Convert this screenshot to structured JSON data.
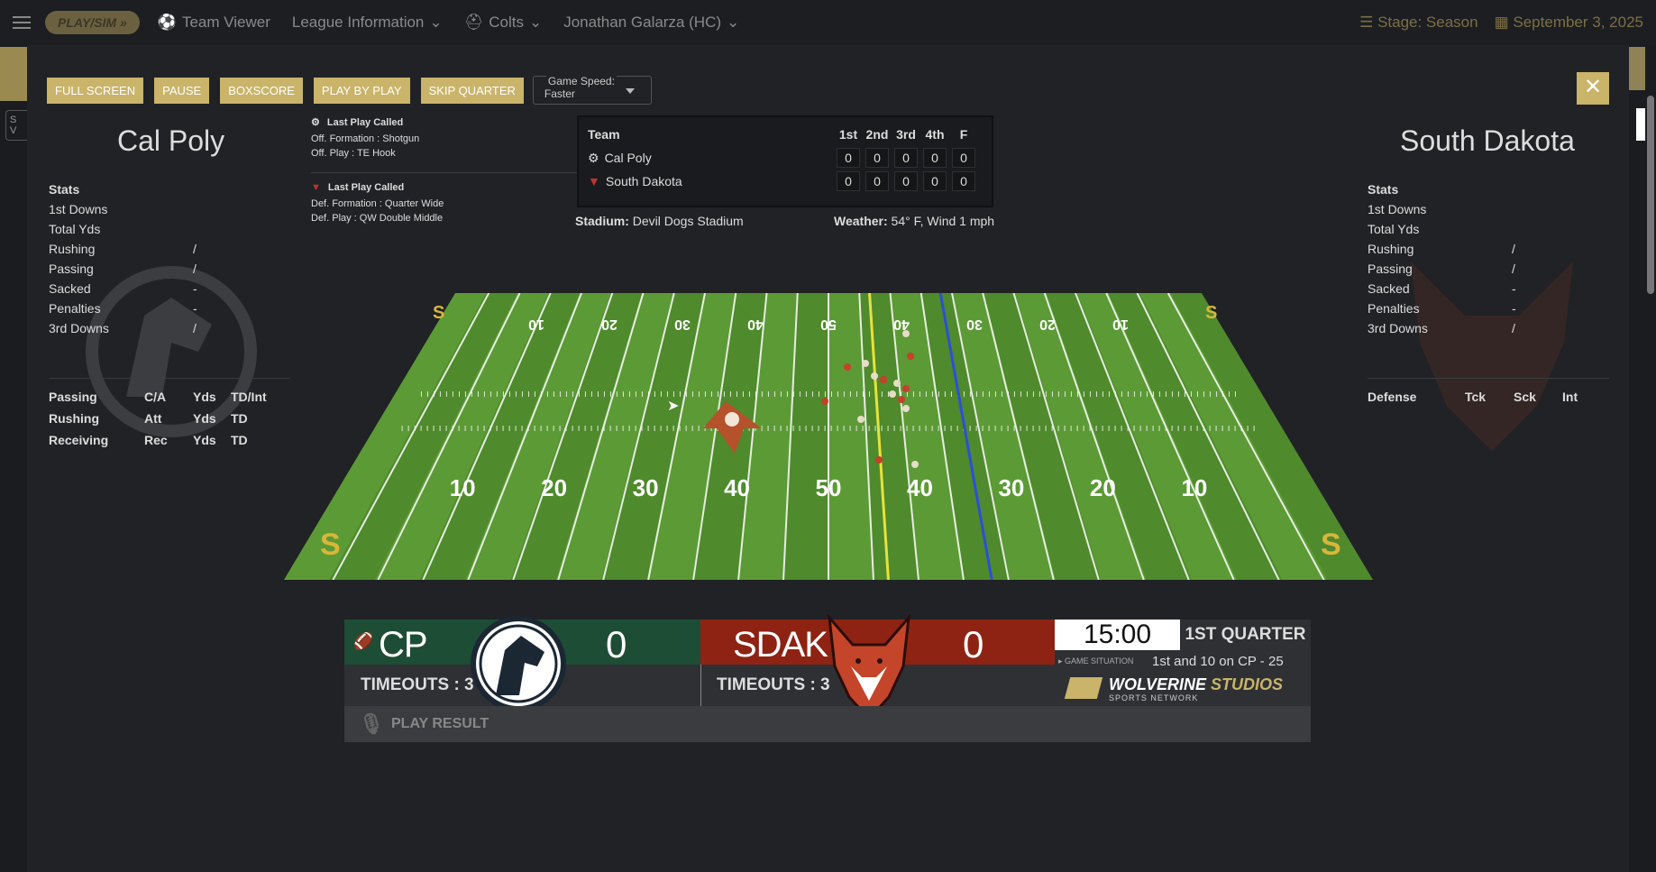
{
  "nav": {
    "playsim": "PLAY/SIM",
    "items": [
      "Team Viewer",
      "League Information",
      "Colts",
      "Jonathan Galarza (HC)"
    ],
    "stage": "Stage: Season",
    "date": "September 3, 2025"
  },
  "bg": {
    "left_box_letters": "S",
    "left_box_letters2": "V"
  },
  "controls": {
    "buttons": [
      "FULL SCREEN",
      "PAUSE",
      "BOXSCORE",
      "PLAY BY PLAY",
      "SKIP QUARTER"
    ],
    "speed_label": "Game Speed:",
    "speed_value": "Faster"
  },
  "home": {
    "name": "Cal Poly",
    "stats_header": "Stats",
    "stats": [
      {
        "k": "1st Downs",
        "v": ""
      },
      {
        "k": "Total Yds",
        "v": ""
      },
      {
        "k": "Rushing",
        "v": "/"
      },
      {
        "k": "Passing",
        "v": "/"
      },
      {
        "k": "Sacked",
        "v": "-"
      },
      {
        "k": "Penalties",
        "v": "-"
      },
      {
        "k": "3rd Downs",
        "v": "/"
      }
    ],
    "table": [
      [
        "Passing",
        "C/A",
        "Yds",
        "TD/Int"
      ],
      [
        "Rushing",
        "Att",
        "Yds",
        "TD"
      ],
      [
        "Receiving",
        "Rec",
        "Yds",
        "TD"
      ]
    ]
  },
  "away": {
    "name": "South Dakota",
    "stats_header": "Stats",
    "stats": [
      {
        "k": "1st Downs",
        "v": ""
      },
      {
        "k": "Total Yds",
        "v": ""
      },
      {
        "k": "Rushing",
        "v": "/"
      },
      {
        "k": "Passing",
        "v": "/"
      },
      {
        "k": "Sacked",
        "v": "-"
      },
      {
        "k": "Penalties",
        "v": "-"
      },
      {
        "k": "3rd Downs",
        "v": "/"
      }
    ],
    "defense": [
      "Defense",
      "Tck",
      "Sck",
      "Int"
    ]
  },
  "lastplay_off": {
    "title": "Last Play Called",
    "formation": "Off. Formation : Shotgun",
    "play": "Off. Play : TE Hook"
  },
  "lastplay_def": {
    "title": "Last Play Called",
    "formation": "Def. Formation : Quarter Wide",
    "play": "Def. Play : QW Double Middle"
  },
  "linescore": {
    "headers": [
      "Team",
      "1st",
      "2nd",
      "3rd",
      "4th",
      "F"
    ],
    "rows": [
      {
        "team": "Cal Poly",
        "scores": [
          "0",
          "0",
          "0",
          "0",
          "0"
        ]
      },
      {
        "team": "South Dakota",
        "scores": [
          "0",
          "0",
          "0",
          "0",
          "0"
        ]
      }
    ]
  },
  "stadium_label": "Stadium:",
  "stadium": "Devil Dogs Stadium",
  "weather_label": "Weather:",
  "weather": "54° F, Wind 1 mph",
  "field": {
    "near_numbers": [
      "10",
      "20",
      "30",
      "40",
      "50",
      "40",
      "30",
      "20",
      "10"
    ],
    "far_numbers": [
      "10",
      "20",
      "30",
      "40",
      "50",
      "40",
      "30",
      "20",
      "10"
    ]
  },
  "scorebug": {
    "home_abbr": "CP",
    "home_score": "0",
    "away_abbr": "SDAK",
    "away_score": "0",
    "home_timeouts": "TIMEOUTS : 3",
    "away_timeouts": "TIMEOUTS : 3",
    "clock": "15:00",
    "quarter": "1ST QUARTER",
    "situation_label": "GAME SITUATION",
    "situation": "1st and 10 on CP - 25",
    "brand1": "WOLVERINE",
    "brand2": "STUDIOS",
    "brand_sub": "SPORTS NETWORK",
    "play_result": "PLAY RESULT"
  },
  "colors": {
    "gold": "#c9b46a",
    "home": "#1e4d35",
    "away": "#8e2313",
    "field": "#4f8a2c"
  }
}
